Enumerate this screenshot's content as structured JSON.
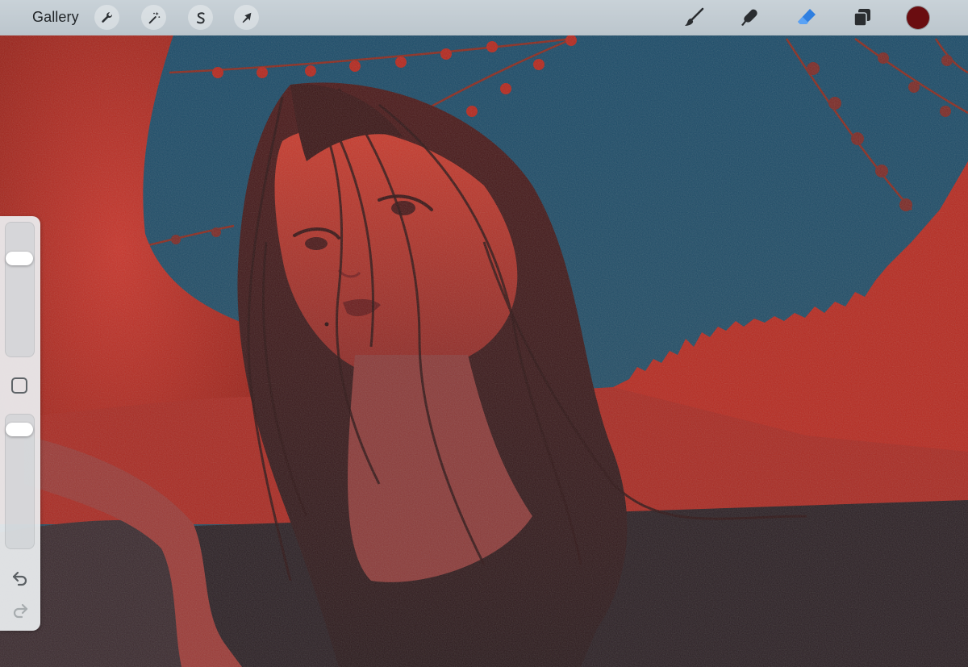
{
  "topbar": {
    "gallery_label": "Gallery",
    "left_tools": [
      {
        "name": "actions",
        "icon": "wrench-icon"
      },
      {
        "name": "adjustments",
        "icon": "magic-wand-icon"
      },
      {
        "name": "selection",
        "icon": "selection-s-icon"
      },
      {
        "name": "transform",
        "icon": "arrow-cursor-icon"
      }
    ],
    "right_tools": [
      {
        "name": "brush",
        "icon": "brush-icon"
      },
      {
        "name": "smudge",
        "icon": "smudge-icon"
      },
      {
        "name": "eraser",
        "icon": "eraser-icon",
        "active": true
      },
      {
        "name": "layers",
        "icon": "layers-icon"
      }
    ],
    "current_color": "#6a0d10",
    "accent_color": "#2f7fe0"
  },
  "sidebar": {
    "brush_size_level": 0.76,
    "opacity_level": 0.93,
    "modify_icon": "square-icon",
    "undo_icon": "undo-arrow-icon",
    "redo_icon": "redo-arrow-icon"
  },
  "canvas": {
    "description_colors": {
      "sky": "#1d4a66",
      "red_fabric": "#b8291e",
      "dark": "#2a1c22"
    }
  }
}
